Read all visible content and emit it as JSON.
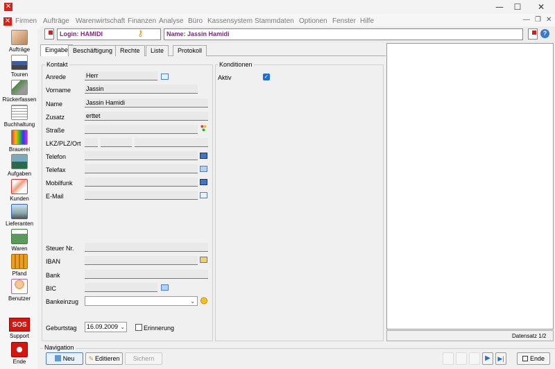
{
  "window": {
    "minimize": "—",
    "maximize": "☐",
    "close": "✕",
    "app_icon": "✕"
  },
  "menu": [
    "Firmen",
    "Aufträge",
    "Warenwirtschaft",
    "Finanzen",
    "Analyse",
    "Büro",
    "Kassensystem",
    "Stammdaten",
    "Optionen",
    "Fenster",
    "Hilfe"
  ],
  "menu_controls": {
    "min": "—",
    "restore": "❐",
    "close": "✕"
  },
  "toolbar": [
    "Aufträge",
    "Touren",
    "Rückerfassen",
    "Buchhaltung",
    "Brauerei",
    "Aufgaben",
    "Kunden",
    "Lieferanten",
    "Waren",
    "Pfand",
    "Benutzer"
  ],
  "support": {
    "label": "Support",
    "badge": "SOS"
  },
  "exit": {
    "label": "Ende"
  },
  "header": {
    "login": "Login: HAMIDI",
    "name": "Name: Jassin Hamidi",
    "help": "?"
  },
  "tabs": [
    "Eingabe",
    "Beschäftigung",
    "Rechte",
    "Liste",
    "Protokoll"
  ],
  "kontakt": {
    "title": "Kontakt",
    "anrede_label": "Anrede",
    "anrede": "Herr",
    "vorname_label": "Vorname",
    "vorname": "Jassin",
    "name_label": "Name",
    "name": "Jassin Hamidi",
    "zusatz_label": "Zusatz",
    "zusatz": "erttet",
    "strasse_label": "Straße",
    "plz_label": "LKZ/PLZ/Ort",
    "telefon_label": "Telefon",
    "telefax_label": "Telefax",
    "mobil_label": "Mobilfunk",
    "email_label": "E-Mail",
    "steuer_label": "Steuer Nr.",
    "iban_label": "IBAN",
    "bank_label": "Bank",
    "bic_label": "BIC",
    "bankeinzug_label": "Bankeinzug",
    "geburtstag_label": "Geburtstag",
    "geburtstag": "16.09.2009",
    "erinnerung_label": "Erinnerung"
  },
  "konditionen": {
    "title": "Konditionen",
    "aktiv_label": "Aktiv"
  },
  "datensatz": "Datensatz 1/2",
  "navigation": {
    "title": "Navigation",
    "neu": "Neu",
    "editieren": "Editieren",
    "sichern": "Sichern",
    "ende": "Ende"
  }
}
